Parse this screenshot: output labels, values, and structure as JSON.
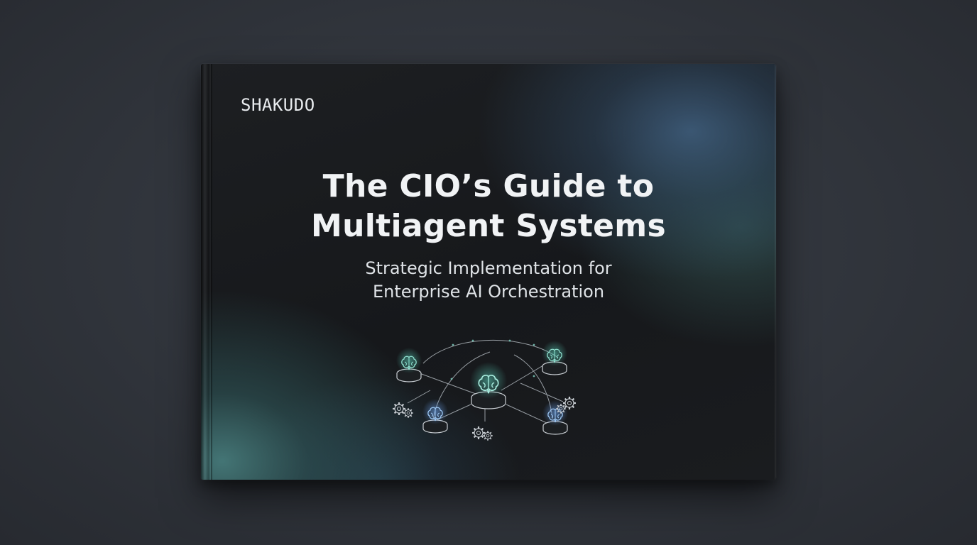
{
  "cover": {
    "brand": "SHAKUDO",
    "title_line1": "The CIO’s Guide to",
    "title_line2": "Multiagent Systems",
    "subtitle_line1": "Strategic Implementation for",
    "subtitle_line2": "Enterprise AI Orchestration"
  },
  "icons": {
    "agent_nodes": [
      "brain-icon",
      "brain-icon",
      "brain-icon",
      "brain-icon",
      "brain-icon"
    ],
    "gear_nodes": [
      "gear-icon",
      "gear-icon",
      "gear-icon"
    ]
  },
  "colors": {
    "background": "#30343b",
    "cover": "#17191c",
    "accent_teal": "#4fb8a6",
    "accent_blue": "#5b8fd6",
    "text": "#f1f3f5"
  }
}
